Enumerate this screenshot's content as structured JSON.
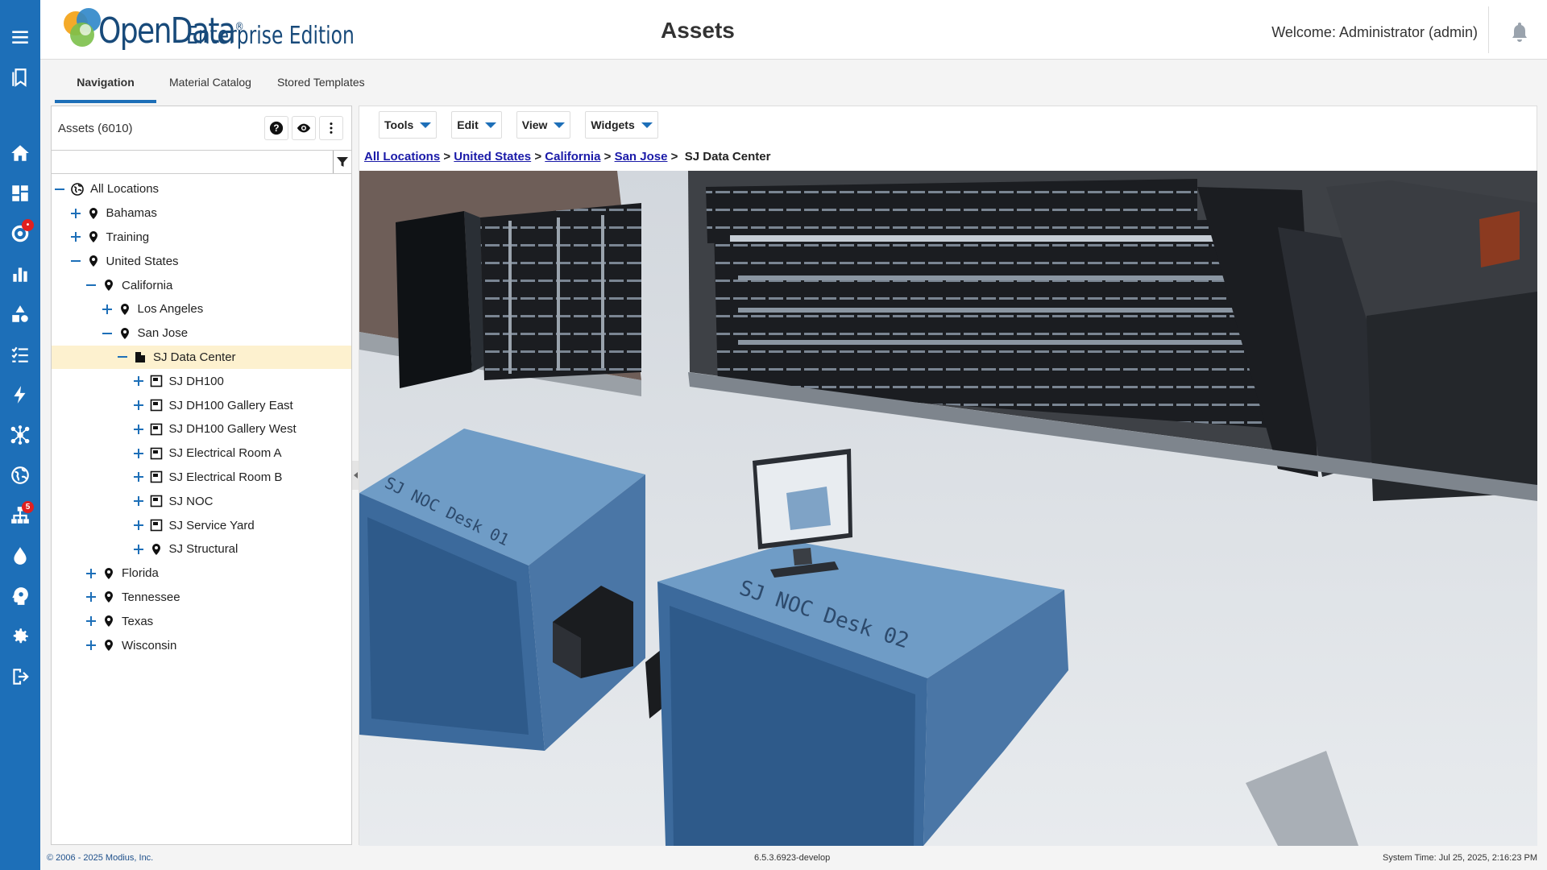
{
  "app": {
    "logo_name": "OpenData",
    "logo_registered": "®",
    "logo_edition": "Enterprise Edition",
    "page_title": "Assets",
    "welcome": "Welcome: Administrator (admin)"
  },
  "rail": {
    "items": [
      {
        "icon": "menu-icon"
      },
      {
        "icon": "bookmark-icon"
      },
      {
        "icon": "home-icon"
      },
      {
        "icon": "dashboard-icon"
      },
      {
        "icon": "settings-alert-icon",
        "badge": "•"
      },
      {
        "icon": "bar-chart-icon"
      },
      {
        "icon": "shapes-icon"
      },
      {
        "icon": "checklist-icon"
      },
      {
        "icon": "lightning-icon"
      },
      {
        "icon": "network-icon"
      },
      {
        "icon": "globe-icon"
      },
      {
        "icon": "hierarchy-icon",
        "badge": "5"
      },
      {
        "icon": "water-drop-icon"
      },
      {
        "icon": "brain-icon"
      },
      {
        "icon": "gear-icon"
      },
      {
        "icon": "logout-icon"
      }
    ]
  },
  "tabs": [
    {
      "label": "Navigation",
      "active": true
    },
    {
      "label": "Material Catalog",
      "active": false
    },
    {
      "label": "Stored Templates",
      "active": false
    }
  ],
  "assets_panel": {
    "title": "Assets (6010)",
    "search_value": "",
    "tree": [
      {
        "label": "All Locations",
        "icon": "globe-icon",
        "level": 0,
        "expander": "minus"
      },
      {
        "label": "Bahamas",
        "icon": "location-pin-icon",
        "level": 1,
        "expander": "plus"
      },
      {
        "label": "Training",
        "icon": "location-pin-icon",
        "level": 1,
        "expander": "plus"
      },
      {
        "label": "United States",
        "icon": "location-pin-icon",
        "level": 1,
        "expander": "minus"
      },
      {
        "label": "California",
        "icon": "location-pin-icon",
        "level": 2,
        "expander": "minus"
      },
      {
        "label": "Los Angeles",
        "icon": "location-pin-icon",
        "level": 3,
        "expander": "plus"
      },
      {
        "label": "San Jose",
        "icon": "location-pin-icon",
        "level": 3,
        "expander": "minus"
      },
      {
        "label": "SJ Data Center",
        "icon": "building-icon",
        "level": 4,
        "expander": "minus",
        "selected": true
      },
      {
        "label": "SJ DH100",
        "icon": "room-icon",
        "level": 5,
        "expander": "plus"
      },
      {
        "label": "SJ DH100 Gallery East",
        "icon": "room-icon",
        "level": 5,
        "expander": "plus"
      },
      {
        "label": "SJ DH100 Gallery West",
        "icon": "room-icon",
        "level": 5,
        "expander": "plus"
      },
      {
        "label": "SJ Electrical Room A",
        "icon": "room-icon",
        "level": 5,
        "expander": "plus"
      },
      {
        "label": "SJ Electrical Room B",
        "icon": "room-icon",
        "level": 5,
        "expander": "plus"
      },
      {
        "label": "SJ NOC",
        "icon": "room-icon",
        "level": 5,
        "expander": "plus"
      },
      {
        "label": "SJ Service Yard",
        "icon": "room-icon",
        "level": 5,
        "expander": "plus"
      },
      {
        "label": "SJ Structural",
        "icon": "location-pin-icon",
        "level": 5,
        "expander": "plus"
      },
      {
        "label": "Florida",
        "icon": "location-pin-icon",
        "level": 2,
        "expander": "plus"
      },
      {
        "label": "Tennessee",
        "icon": "location-pin-icon",
        "level": 2,
        "expander": "plus"
      },
      {
        "label": "Texas",
        "icon": "location-pin-icon",
        "level": 2,
        "expander": "plus"
      },
      {
        "label": "Wisconsin",
        "icon": "location-pin-icon",
        "level": 2,
        "expander": "plus"
      }
    ]
  },
  "toolbar": {
    "tools": "Tools",
    "edit": "Edit",
    "view": "View",
    "widgets": "Widgets"
  },
  "breadcrumb": {
    "items": [
      "All Locations",
      "United States",
      "California",
      "San Jose"
    ],
    "sep": ">",
    "current": "SJ Data Center"
  },
  "scene": {
    "desk1_label": "SJ NOC Desk 01",
    "desk2_label": "SJ NOC Desk 02"
  },
  "footer": {
    "copyright": "© 2006 - 2025 Modius, Inc.",
    "version": "6.5.3.6923-develop",
    "system_time": "System Time: Jul 25, 2025, 2:16:23 PM"
  },
  "colors": {
    "rail": "#1d6fb8",
    "accent": "#1d6fb8",
    "selected_row": "#fdf1cf",
    "badge": "#e02020",
    "desk": "#6f9cc6"
  }
}
